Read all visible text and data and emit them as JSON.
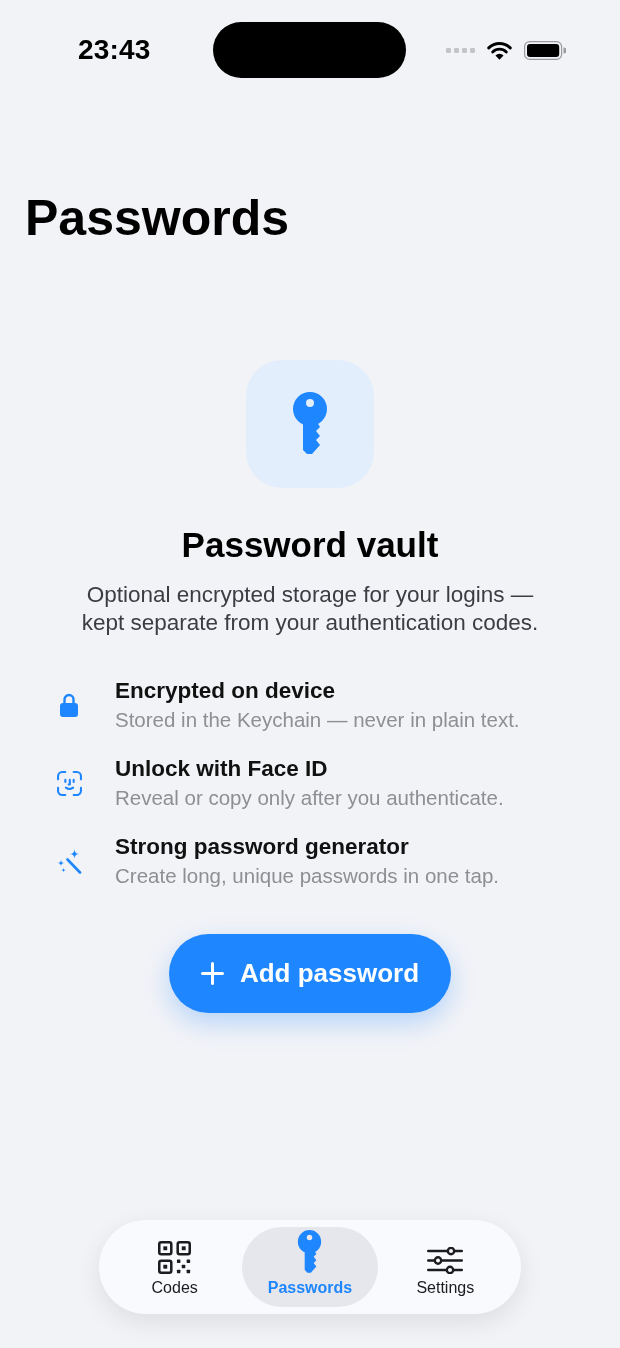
{
  "status_bar": {
    "time": "23:43"
  },
  "title": "Passwords",
  "empty_state": {
    "title": "Password vault",
    "description": "Optional encrypted storage for your logins — kept separate from your authentication codes.",
    "features": [
      {
        "kind": "lock",
        "title": "Encrypted on device",
        "description": "Stored in the Keychain — never in plain text."
      },
      {
        "kind": "face",
        "title": "Unlock with Face ID",
        "description": "Reveal or copy only after you authenticate."
      },
      {
        "kind": "wand",
        "title": "Strong password generator",
        "description": "Create long, unique passwords in one tap."
      }
    ],
    "button": {
      "label": "Add password"
    }
  },
  "tab_bar": {
    "tabs": [
      {
        "kind": "qr",
        "label": "Codes",
        "selected": false
      },
      {
        "kind": "key",
        "label": "Passwords",
        "selected": true
      },
      {
        "kind": "sliders",
        "label": "Settings",
        "selected": false
      }
    ]
  }
}
